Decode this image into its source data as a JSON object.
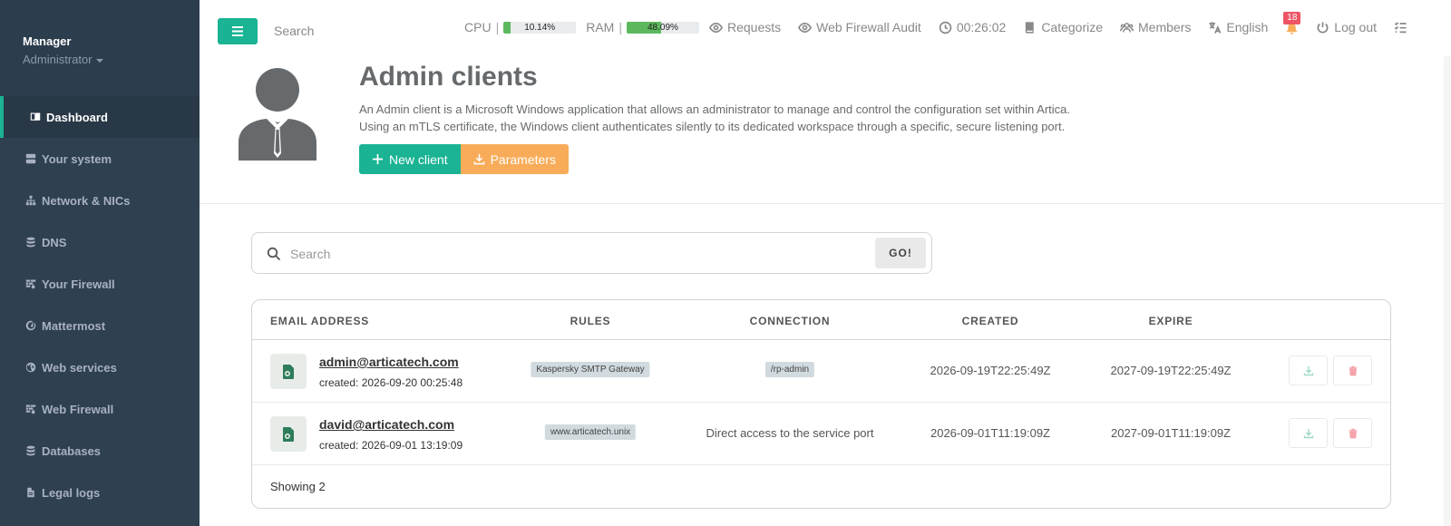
{
  "sidebar": {
    "user_name": "Manager",
    "user_role": "Administrator",
    "items": [
      {
        "label": "Dashboard",
        "icon": "book-open-icon"
      },
      {
        "label": "Your system",
        "icon": "server-icon"
      },
      {
        "label": "Network & NICs",
        "icon": "network-icon"
      },
      {
        "label": "DNS",
        "icon": "database-icon"
      },
      {
        "label": "Your Firewall",
        "icon": "firewall-icon"
      },
      {
        "label": "Mattermost",
        "icon": "mattermost-icon"
      },
      {
        "label": "Web services",
        "icon": "globe-icon"
      },
      {
        "label": "Web Firewall",
        "icon": "firewall-icon"
      },
      {
        "label": "Databases",
        "icon": "databases-icon"
      },
      {
        "label": "Legal logs",
        "icon": "file-icon"
      }
    ]
  },
  "topbar": {
    "search_placeholder": "Search",
    "cpu_label": "CPU",
    "cpu_value": "10.14%",
    "cpu_percent": 10.14,
    "ram_label": "RAM",
    "ram_value": "48.09%",
    "ram_percent": 48.09,
    "requests": "Requests",
    "web_firewall_audit": "Web Firewall Audit",
    "clock": "00:26:02",
    "categorize": "Categorize",
    "members": "Members",
    "language": "English",
    "notifications_count": "18",
    "logout": "Log out"
  },
  "header": {
    "title": "Admin clients",
    "description_line1": "An Admin client is a Microsoft Windows application that allows an administrator to manage and control the configuration set within Artica.",
    "description_line2": "Using an mTLS certificate, the Windows client authenticates silently to its dedicated workspace through a specific, secure listening port.",
    "new_client_label": "New client",
    "parameters_label": "Parameters"
  },
  "search": {
    "placeholder": "Search",
    "go_label": "GO!"
  },
  "table": {
    "columns": [
      "EMAIL ADDRESS",
      "RULES",
      "CONNECTION",
      "CREATED",
      "EXPIRE"
    ],
    "rows": [
      {
        "email": "admin@articatech.com",
        "created_sub": "created: 2026-09-20 00:25:48",
        "rule": "Kaspersky SMTP Gateway",
        "connection": "/rp-admin",
        "connection_is_tag": true,
        "created": "2026-09-19T22:25:49Z",
        "expire": "2027-09-19T22:25:49Z"
      },
      {
        "email": "david@articatech.com",
        "created_sub": "created: 2026-09-01 13:19:09",
        "rule": "www.articatech.unix",
        "connection": "Direct access to the service port",
        "connection_is_tag": false,
        "created": "2026-09-01T11:19:09Z",
        "expire": "2027-09-01T11:19:09Z"
      }
    ],
    "footer": "Showing 2"
  },
  "colors": {
    "sidebar_bg": "#2f4050",
    "accent_green": "#1ab394",
    "accent_orange": "#f8ac59",
    "danger": "#ed5565",
    "progress": "#5cb85c"
  }
}
